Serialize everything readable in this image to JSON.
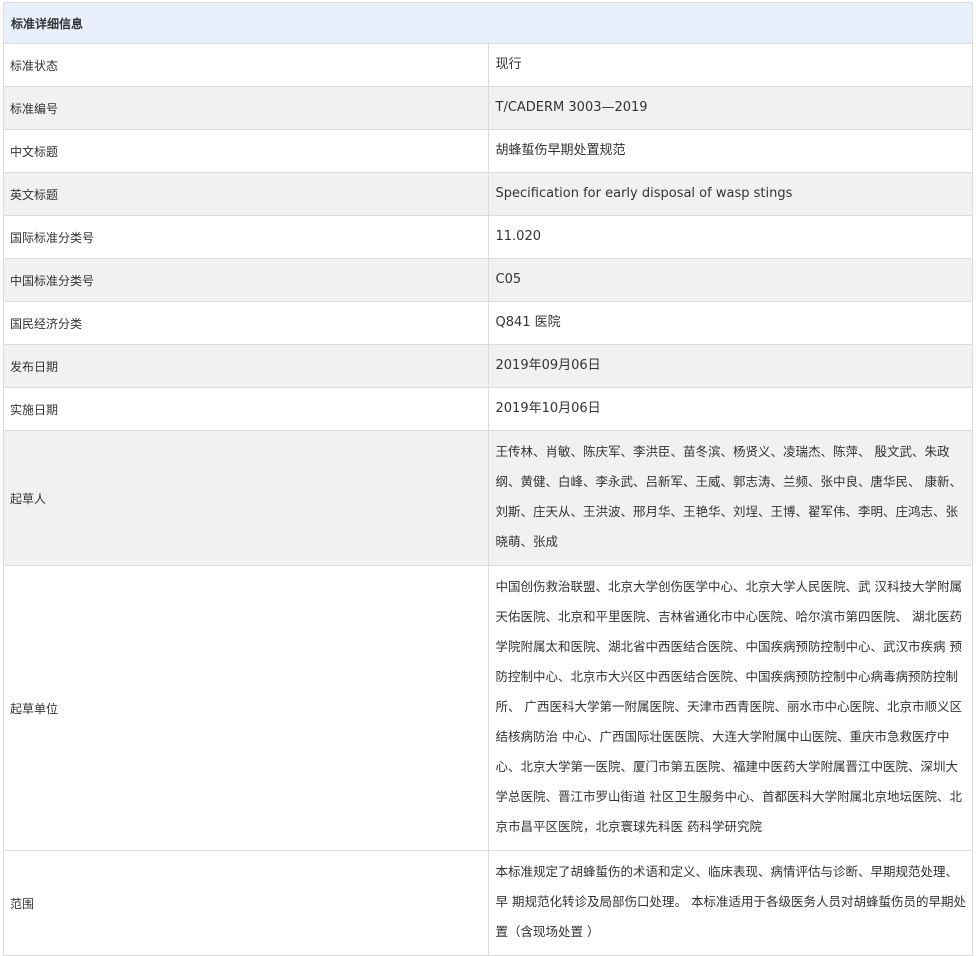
{
  "title": "标准详细信息",
  "rows": [
    {
      "label": "标准状态",
      "value": "现行"
    },
    {
      "label": "标准编号",
      "value": "T/CADERM 3003—2019"
    },
    {
      "label": "中文标题",
      "value": "胡蜂蜇伤早期处置规范"
    },
    {
      "label": "英文标题",
      "value": "Specification for early disposal of wasp stings"
    },
    {
      "label": "国际标准分类号",
      "value": "11.020"
    },
    {
      "label": "中国标准分类号",
      "value": "C05"
    },
    {
      "label": "国民经济分类",
      "value": "Q841 医院"
    },
    {
      "label": "发布日期",
      "value": "2019年09月06日"
    },
    {
      "label": "实施日期",
      "value": "2019年10月06日"
    },
    {
      "label": "起草人",
      "value": "王传林、肖敏、陈庆军、李洪臣、苗冬滨、杨贤义、凌瑞杰、陈萍、 殷文武、朱政纲、黄健、白峰、李永武、吕新军、王威、郭志涛、兰频、张中良、唐华民、 康新、刘斯、庄天从、王洪波、邢月华、王艳华、刘埕、王博、翟军伟、李明、庄鸿志、张 晓萌、张成"
    },
    {
      "label": "起草单位",
      "value": "中国创伤救治联盟、北京大学创伤医学中心、北京大学人民医院、武 汉科技大学附属天佑医院、北京和平里医院、吉林省通化市中心医院、哈尔滨市第四医院、 湖北医药学院附属太和医院、湖北省中西医结合医院、中国疾病预防控制中心、武汉市疾病 预防控制中心、北京市大兴区中西医结合医院、中国疾病预防控制中心病毒病预防控制所、 广西医科大学第一附属医院、天津市西青医院、丽水市中心医院、北京市顺义区结核病防治 中心、广西国际壮医医院、大连大学附属中山医院、重庆市急救医疗中心、北京大学第一医院、厦门市第五医院、福建中医药大学附属晋江中医院、深圳大学总医院、晋江市罗山街道 社区卫生服务中心、首都医科大学附属北京地坛医院、北京市昌平区医院，北京寰球先科医 药科学研究院"
    },
    {
      "label": "范围",
      "value": "本标准规定了胡蜂蜇伤的术语和定义、临床表现、病情评估与诊断、早期规范处理、早 期规范化转诊及局部伤口处理。 本标准适用于各级医务人员对胡蜂蜇伤员的早期处置（含现场处置 ）"
    }
  ]
}
